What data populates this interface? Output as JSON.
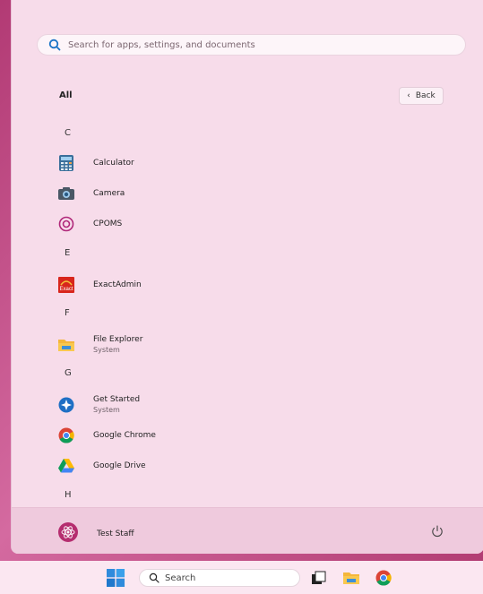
{
  "search": {
    "placeholder": "Search for apps, settings, and documents"
  },
  "header": {
    "all_label": "All",
    "back_label": "Back"
  },
  "letters": {
    "c": "C",
    "e": "E",
    "f": "F",
    "g": "G",
    "h": "H"
  },
  "apps": [
    {
      "name": "Calculator",
      "sub": ""
    },
    {
      "name": "Camera",
      "sub": ""
    },
    {
      "name": "CPOMS",
      "sub": ""
    },
    {
      "name": "ExactAdmin",
      "sub": ""
    },
    {
      "name": "File Explorer",
      "sub": "System"
    },
    {
      "name": "Get Started",
      "sub": "System"
    },
    {
      "name": "Google Chrome",
      "sub": ""
    },
    {
      "name": "Google Drive",
      "sub": ""
    }
  ],
  "exact_icon_text": "Exact",
  "footer": {
    "user_name": "Test Staff"
  },
  "taskbar": {
    "search_label": "Search"
  },
  "colors": {
    "accent": "#1a73c6",
    "start_bg": "#f7dcea"
  }
}
